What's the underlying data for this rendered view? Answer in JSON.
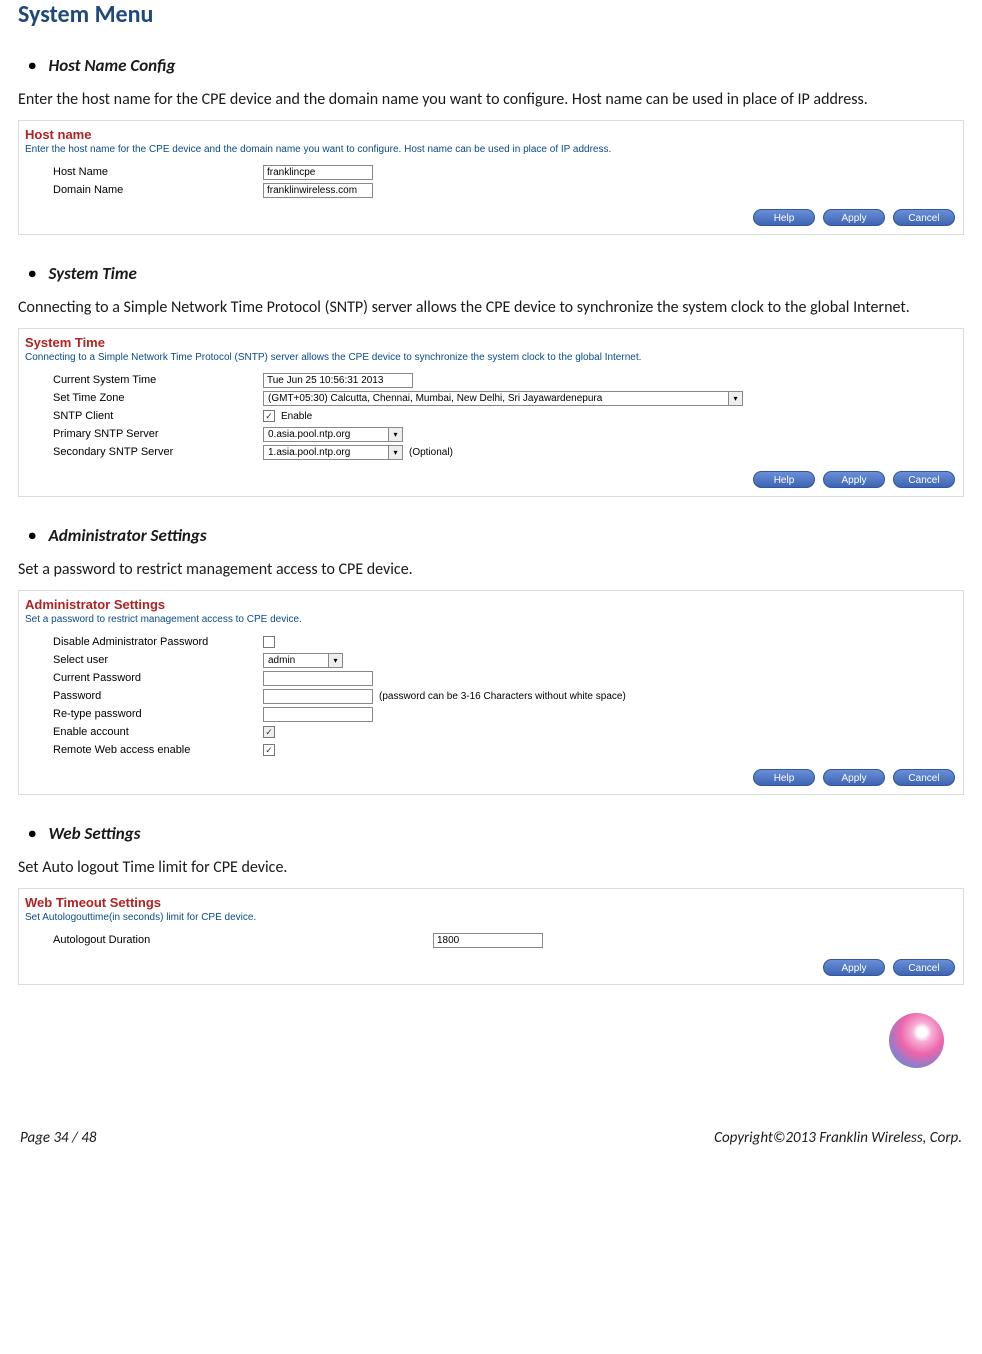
{
  "page_title": "System Menu",
  "sections": {
    "hostname": {
      "heading": "Host Name Config",
      "body": "Enter the host name for the CPE device and the domain name you want to configure. Host name can be used in place of IP address.",
      "panel_title": "Host name",
      "panel_desc": "Enter the host name for the CPE device and the domain name you want to configure. Host name can be used in place of IP address.",
      "host_name_label": "Host Name",
      "host_name_value": "franklincpe",
      "domain_name_label": "Domain Name",
      "domain_name_value": "franklinwireless.com"
    },
    "systime": {
      "heading": "System Time",
      "body": "Connecting to a Simple Network Time Protocol (SNTP) server allows the CPE device to synchronize the system clock to the global Internet.",
      "panel_title": "System Time",
      "panel_desc": "Connecting to a Simple Network Time Protocol (SNTP) server allows the CPE device to synchronize the system clock to the global Internet.",
      "current_time_label": "Current System Time",
      "current_time_value": "Tue Jun 25 10:56:31 2013",
      "tz_label": "Set Time Zone",
      "tz_value": "(GMT+05:30) Calcutta, Chennai, Mumbai, New Delhi, Sri Jayawardenepura",
      "sntp_client_label": "SNTP Client",
      "sntp_client_text": "Enable",
      "primary_label": "Primary SNTP Server",
      "primary_value": "0.asia.pool.ntp.org",
      "secondary_label": "Secondary SNTP Server",
      "secondary_value": "1.asia.pool.ntp.org",
      "optional_text": "(Optional)"
    },
    "admin": {
      "heading": "Administrator Settings",
      "body": "Set a password to restrict management access to CPE device.",
      "panel_title": "Administrator Settings",
      "panel_desc": "Set a password to restrict management access to CPE device.",
      "disable_pw_label": "Disable Administrator Password",
      "select_user_label": "Select user",
      "select_user_value": "admin",
      "current_pw_label": "Current Password",
      "password_label": "Password",
      "password_hint": "(password can be 3-16 Characters without white space)",
      "retype_label": "Re-type password",
      "enable_account_label": "Enable account",
      "remote_label": "Remote Web access enable"
    },
    "web": {
      "heading": "Web Settings",
      "body": "Set Auto logout Time limit for CPE device.",
      "panel_title": "Web Timeout Settings",
      "panel_desc": "Set Autologouttime(in seconds) limit for CPE device.",
      "autologout_label": "Autologout Duration",
      "autologout_value": "1800"
    }
  },
  "buttons": {
    "help": "Help",
    "apply": "Apply",
    "cancel": "Cancel"
  },
  "footer": {
    "page": "Page  34  /  48",
    "copyright": "Copyright©2013  Franklin  Wireless, Corp."
  }
}
